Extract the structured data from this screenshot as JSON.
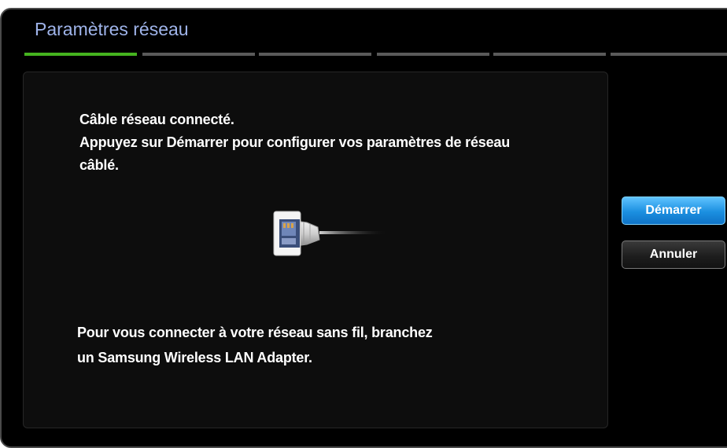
{
  "dialog": {
    "title": "Paramètres réseau",
    "progress": {
      "total_steps": 6,
      "current_step": 1,
      "active_color": "#45b31f"
    }
  },
  "content": {
    "message_lines": [
      "Câble réseau connecté.",
      "Appuyez sur Démarrer pour configurer vos paramètres de réseau",
      "câblé."
    ],
    "graphic_icon": "ethernet-cable-icon",
    "note_lines": [
      "Pour vous connecter à votre réseau sans fil, branchez",
      "un Samsung Wireless LAN Adapter."
    ]
  },
  "buttons": {
    "start_label": "Démarrer",
    "cancel_label": "Annuler",
    "start_color": "#1b8fe0"
  }
}
